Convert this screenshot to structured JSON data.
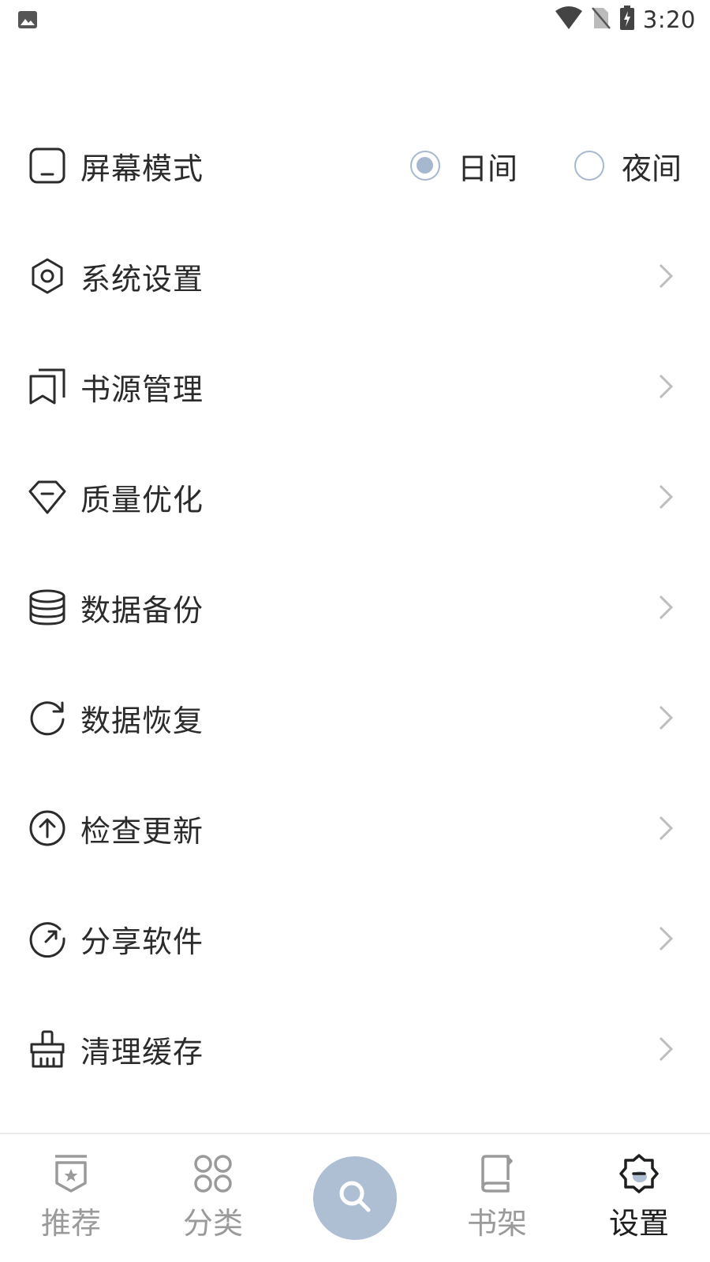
{
  "status_bar": {
    "time": "3:20"
  },
  "screen_mode": {
    "label": "屏幕模式",
    "options": [
      {
        "label": "日间",
        "selected": true
      },
      {
        "label": "夜间",
        "selected": false
      }
    ]
  },
  "menu_items": [
    {
      "label": "系统设置",
      "icon": "gear-icon"
    },
    {
      "label": "书源管理",
      "icon": "bookmark-icon"
    },
    {
      "label": "质量优化",
      "icon": "diamond-icon"
    },
    {
      "label": "数据备份",
      "icon": "database-icon"
    },
    {
      "label": "数据恢复",
      "icon": "refresh-icon"
    },
    {
      "label": "检查更新",
      "icon": "upload-circle-icon"
    },
    {
      "label": "分享软件",
      "icon": "share-icon"
    },
    {
      "label": "清理缓存",
      "icon": "brush-icon"
    }
  ],
  "tabs": [
    {
      "label": "推荐",
      "icon": "badge-star-icon",
      "active": false
    },
    {
      "label": "分类",
      "icon": "grid-icon",
      "active": false
    },
    {
      "label": "",
      "icon": "search-icon",
      "active": false
    },
    {
      "label": "书架",
      "icon": "book-icon",
      "active": false
    },
    {
      "label": "设置",
      "icon": "settings-icon",
      "active": true
    }
  ],
  "colors": {
    "accent": "#aebfd4",
    "text": "#2b2b2b",
    "inactive_tab": "#9a9a9a",
    "chevron": "#bdbdbd"
  }
}
